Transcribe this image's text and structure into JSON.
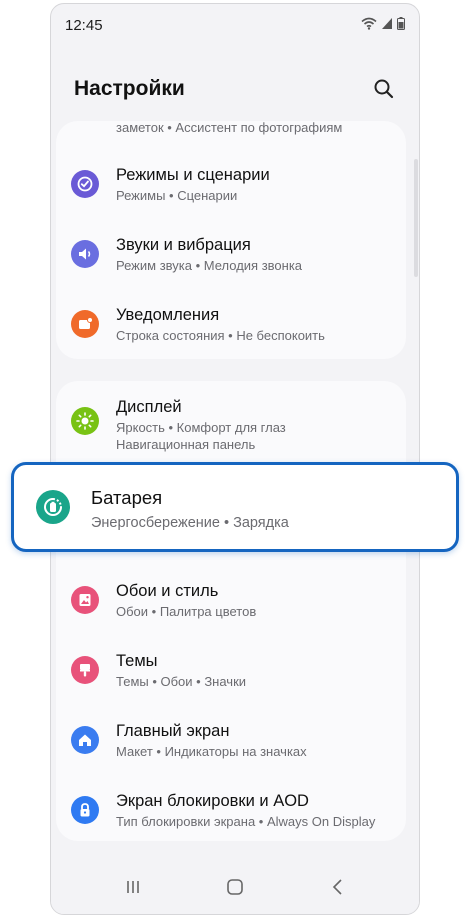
{
  "status": {
    "time": "12:45"
  },
  "header": {
    "title": "Настройки"
  },
  "card1": {
    "partial_sub": "заметок  •  Ассистент по фотографиям",
    "items": [
      {
        "title": "Режимы и сценарии",
        "sub": "Режимы  •  Сценарии",
        "icon": "modes-icon",
        "color": "#6a5ad6"
      },
      {
        "title": "Звуки и вибрация",
        "sub": "Режим звука  •  Мелодия звонка",
        "icon": "sound-icon",
        "color": "#6a6ee0"
      },
      {
        "title": "Уведомления",
        "sub": "Строка состояния  •  Не беспокоить",
        "icon": "notifications-icon",
        "color": "#f06a2a"
      }
    ]
  },
  "display_item": {
    "title": "Дисплей",
    "sub": "Яркость  •  Комфорт для глаз",
    "sub2": "Навигационная панель",
    "icon": "display-icon",
    "color": "#78c214"
  },
  "battery": {
    "title": "Батарея",
    "sub": "Энергосбережение  •  Зарядка",
    "icon": "battery-icon",
    "color": "#1aa58a",
    "highlight_color": "#1565c0"
  },
  "card2": {
    "items": [
      {
        "title": "Обои и стиль",
        "sub": "Обои  •  Палитра цветов",
        "icon": "wallpaper-icon",
        "color": "#e8527a"
      },
      {
        "title": "Темы",
        "sub": "Темы  •  Обои  •  Значки",
        "icon": "themes-icon",
        "color": "#e8527a"
      },
      {
        "title": "Главный экран",
        "sub": "Макет  •  Индикаторы на значках",
        "icon": "home-screen-icon",
        "color": "#3a7cf0"
      },
      {
        "title": "Экран блокировки и AOD",
        "sub": "Тип блокировки экрана  •  Always On Display",
        "icon": "lock-icon",
        "color": "#2f7af2"
      }
    ]
  },
  "navbar": {
    "icons": [
      "recent-apps-icon",
      "home-icon",
      "back-icon"
    ]
  }
}
